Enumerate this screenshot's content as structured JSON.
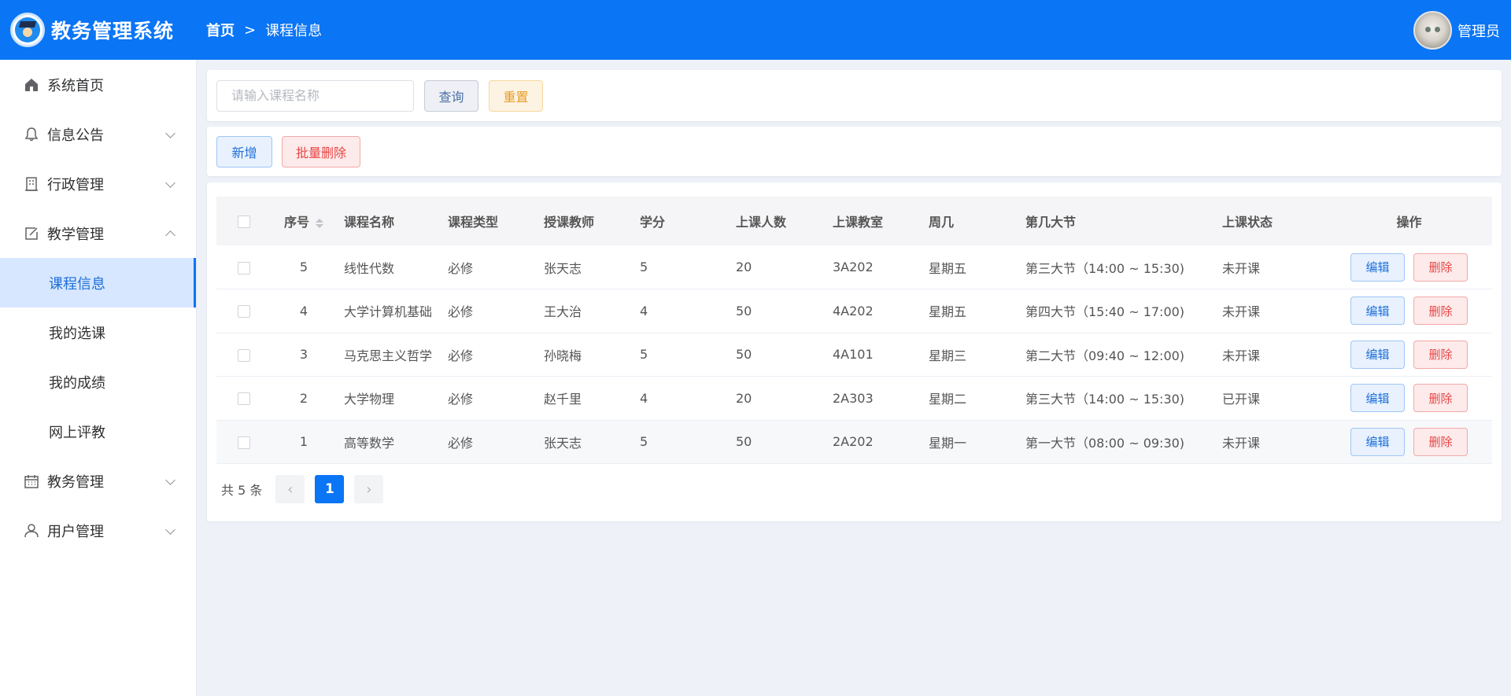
{
  "app": {
    "title": "教务管理系统",
    "logo_icon": "graduation-logo-icon",
    "accent_color": "#0a75f5"
  },
  "breadcrumb": {
    "home": "首页",
    "separator": ">",
    "current": "课程信息"
  },
  "user": {
    "name": "管理员",
    "avatar_icon": "cat-avatar"
  },
  "sidebar": {
    "items": [
      {
        "label": "系统首页",
        "icon": "home-icon"
      },
      {
        "label": "信息公告",
        "icon": "bell-icon"
      },
      {
        "label": "行政管理",
        "icon": "building-icon"
      },
      {
        "label": "教学管理",
        "icon": "edit-icon",
        "expanded": true
      },
      {
        "label": "教务管理",
        "icon": "calendar-icon"
      },
      {
        "label": "用户管理",
        "icon": "user-icon"
      }
    ],
    "sub_items": [
      {
        "label": "课程信息",
        "active": true
      },
      {
        "label": "我的选课"
      },
      {
        "label": "我的成绩"
      },
      {
        "label": "网上评教"
      }
    ]
  },
  "search": {
    "placeholder": "请输入课程名称",
    "query_label": "查询",
    "reset_label": "重置"
  },
  "actions": {
    "add_label": "新增",
    "bulk_delete_label": "批量删除"
  },
  "table": {
    "columns": [
      "序号",
      "课程名称",
      "课程类型",
      "授课教师",
      "学分",
      "上课人数",
      "上课教室",
      "周几",
      "第几大节",
      "上课状态",
      "操作"
    ],
    "rows": [
      {
        "idx": "5",
        "name": "线性代数",
        "type": "必修",
        "teacher": "张天志",
        "credit": "5",
        "count": "20",
        "room": "3A202",
        "weekday": "星期五",
        "period": "第三大节（14:00 ~ 15:30)",
        "status": "未开课"
      },
      {
        "idx": "4",
        "name": "大学计算机基础",
        "type": "必修",
        "teacher": "王大治",
        "credit": "4",
        "count": "50",
        "room": "4A202",
        "weekday": "星期五",
        "period": "第四大节（15:40 ~ 17:00)",
        "status": "未开课"
      },
      {
        "idx": "3",
        "name": "马克思主义哲学",
        "type": "必修",
        "teacher": "孙晓梅",
        "credit": "5",
        "count": "50",
        "room": "4A101",
        "weekday": "星期三",
        "period": "第二大节（09:40 ~ 12:00)",
        "status": "未开课"
      },
      {
        "idx": "2",
        "name": "大学物理",
        "type": "必修",
        "teacher": "赵千里",
        "credit": "4",
        "count": "20",
        "room": "2A303",
        "weekday": "星期二",
        "period": "第三大节（14:00 ~ 15:30)",
        "status": "已开课"
      },
      {
        "idx": "1",
        "name": "高等数学",
        "type": "必修",
        "teacher": "张天志",
        "credit": "5",
        "count": "50",
        "room": "2A202",
        "weekday": "星期一",
        "period": "第一大节（08:00 ~ 09:30)",
        "status": "未开课"
      }
    ],
    "edit_label": "编辑",
    "delete_label": "删除"
  },
  "pagination": {
    "total_text": "共 5 条",
    "current_page": "1",
    "prev_icon": "chevron-left-icon",
    "next_icon": "chevron-right-icon"
  }
}
